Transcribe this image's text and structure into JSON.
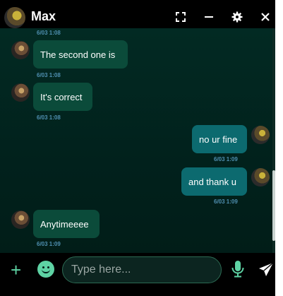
{
  "header": {
    "title": "Max"
  },
  "messages": [
    {
      "time": "6/03 1:08"
    },
    {
      "text": "The second one is",
      "time": "6/03 1:08"
    },
    {
      "text": "It's correct",
      "time": "6/03 1:08"
    },
    {
      "text": "no ur fine",
      "time": "6/03 1:09"
    },
    {
      "text": "and thank u",
      "time": "6/03 1:09"
    },
    {
      "text": "Anytimeeee",
      "time": "6/03 1:09"
    }
  ],
  "composer": {
    "placeholder": "Type here..."
  },
  "colors": {
    "accent": "#5ed3a4",
    "bubble_in": "#0b4b3a",
    "bubble_out": "#0c6a6f",
    "background": "#011d18",
    "timestamp": "#4f8fb0"
  },
  "icons": [
    "expand-icon",
    "minimize-icon",
    "gear-icon",
    "close-icon",
    "plus-icon",
    "emoji-icon",
    "mic-icon",
    "send-icon"
  ]
}
